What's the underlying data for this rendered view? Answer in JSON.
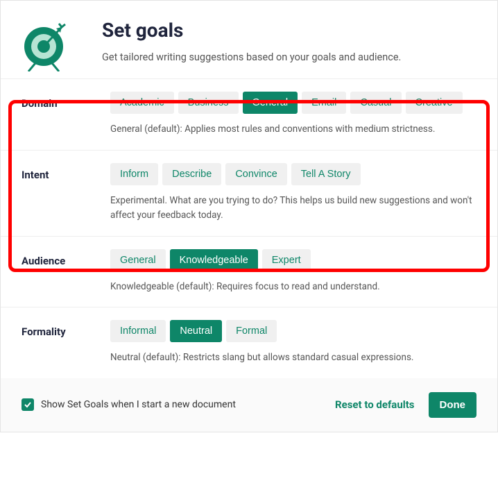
{
  "header": {
    "title": "Set goals",
    "subtitle": "Get tailored writing suggestions based on your goals and audience."
  },
  "sections": {
    "domain": {
      "label": "Domain",
      "options": [
        "Academic",
        "Business",
        "General",
        "Email",
        "Casual",
        "Creative"
      ],
      "selected": "General",
      "description": "General (default): Applies most rules and conventions with medium strictness."
    },
    "intent": {
      "label": "Intent",
      "options": [
        "Inform",
        "Describe",
        "Convince",
        "Tell A Story"
      ],
      "selected": null,
      "description": "Experimental. What are you trying to do? This helps us build new suggestions and won't affect your feedback today."
    },
    "audience": {
      "label": "Audience",
      "options": [
        "General",
        "Knowledgeable",
        "Expert"
      ],
      "selected": "Knowledgeable",
      "description": "Knowledgeable (default): Requires focus to read and understand."
    },
    "formality": {
      "label": "Formality",
      "options": [
        "Informal",
        "Neutral",
        "Formal"
      ],
      "selected": "Neutral",
      "description": "Neutral (default): Restricts slang but allows standard casual expressions."
    }
  },
  "footer": {
    "checkbox_label": "Show Set Goals when I start a new document",
    "checkbox_checked": true,
    "reset_label": "Reset to defaults",
    "done_label": "Done"
  },
  "colors": {
    "accent": "#0e8668",
    "highlight": "#ff0000"
  }
}
